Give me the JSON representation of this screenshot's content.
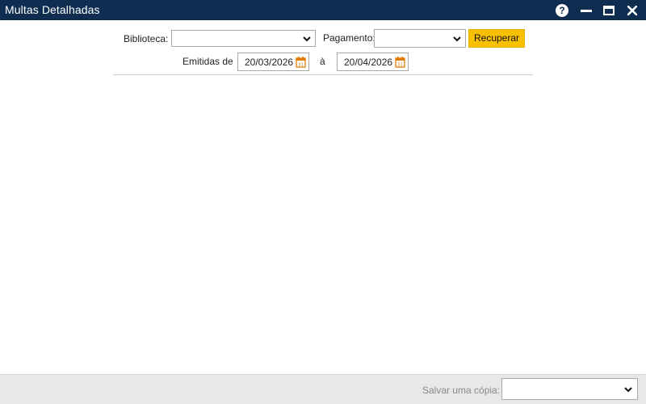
{
  "window": {
    "title": "Multas Detalhadas",
    "icons": [
      "help-icon",
      "minimize-icon",
      "maximize-icon",
      "close-icon"
    ],
    "title_bar_color": "#0f2d50"
  },
  "filters": {
    "library_label": "Biblioteca:",
    "library_value": "",
    "payment_label": "Pagamento:",
    "payment_value": "",
    "retrieve_label": "Recuperar",
    "issued_from_label": "Emitidas de",
    "date_from": "20/03/2026",
    "to_label": "à",
    "date_to": "20/04/2026",
    "accent_color": "#f9c000"
  },
  "footer": {
    "save_copy_label": "Salvar uma cópia:",
    "save_copy_value": ""
  }
}
